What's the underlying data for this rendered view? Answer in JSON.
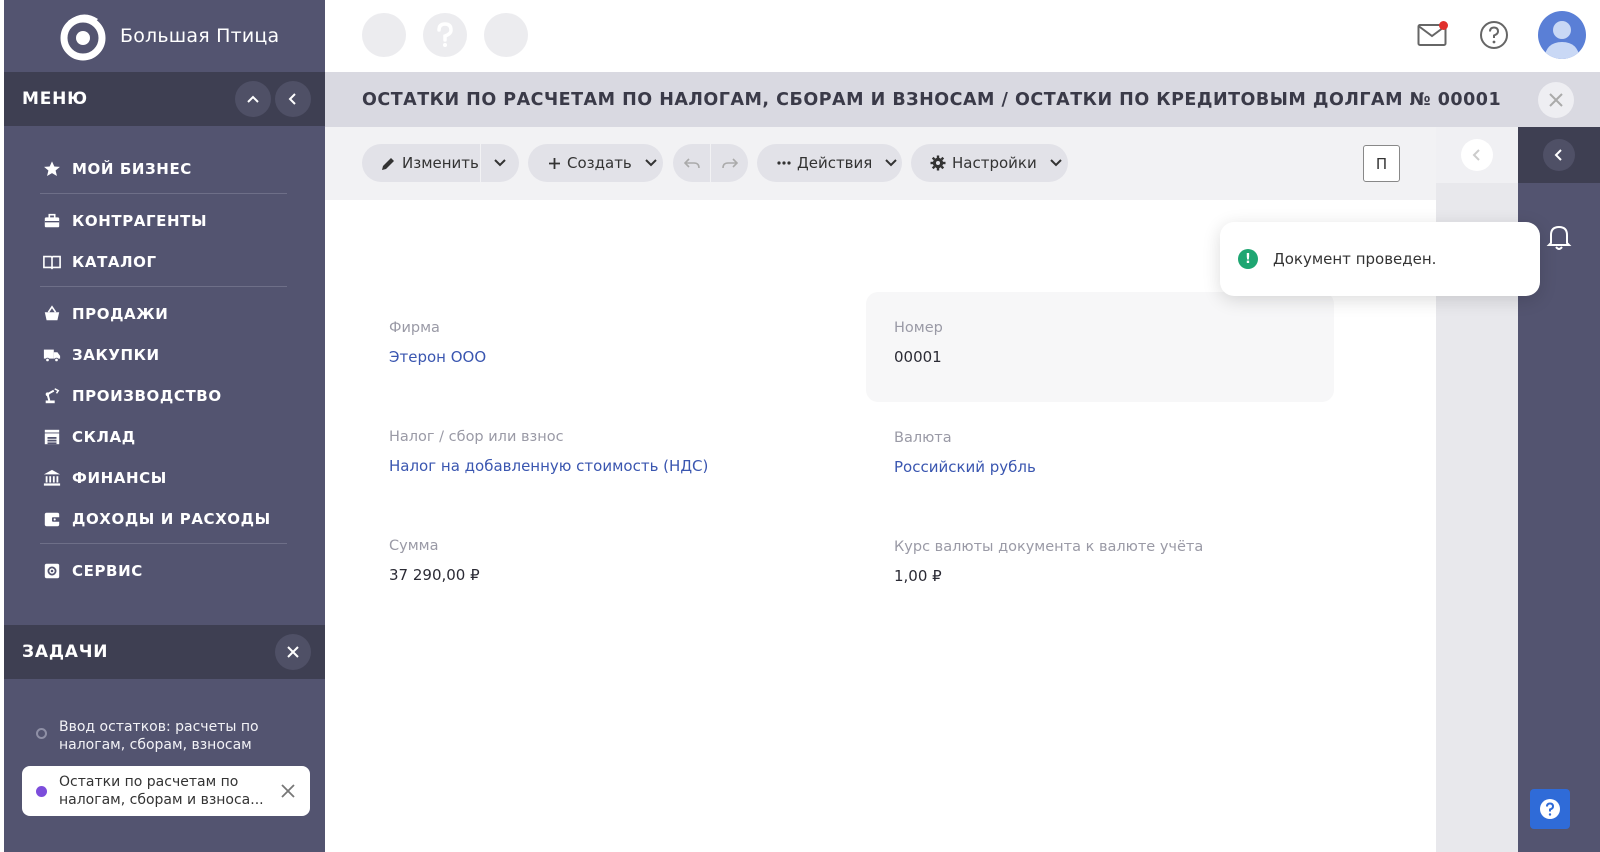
{
  "brand": {
    "name": "Большая Птица"
  },
  "menu": {
    "title": "МЕНЮ",
    "items": [
      {
        "label": "МОЙ БИЗНЕС",
        "icon": "star-icon"
      },
      {
        "label": "КОНТРАГЕНТЫ",
        "icon": "briefcase-icon"
      },
      {
        "label": "КАТАЛОГ",
        "icon": "book-icon"
      },
      {
        "label": "ПРОДАЖИ",
        "icon": "basket-icon"
      },
      {
        "label": "ЗАКУПКИ",
        "icon": "truck-icon"
      },
      {
        "label": "ПРОИЗВОДСТВО",
        "icon": "robot-arm-icon"
      },
      {
        "label": "СКЛАД",
        "icon": "warehouse-icon"
      },
      {
        "label": "ФИНАНСЫ",
        "icon": "bank-icon"
      },
      {
        "label": "ДОХОДЫ И РАСХОДЫ",
        "icon": "wallet-icon"
      },
      {
        "label": "СЕРВИС",
        "icon": "service-icon"
      }
    ]
  },
  "tasks": {
    "title": "ЗАДАЧИ",
    "items": [
      {
        "text": "Ввод остатков: расчеты по налогам, сборам, взносам"
      },
      {
        "text": "Остатки по расчетам по налогам, сборам и взноса..."
      }
    ]
  },
  "page": {
    "title": "ОСТАТКИ ПО РАСЧЕТАМ ПО НАЛОГАМ, СБОРАМ И ВЗНОСАМ / ОСТАТКИ ПО КРЕДИТОВЫМ ДОЛГАМ № 00001"
  },
  "toolbar": {
    "edit_label": "Изменить",
    "create_label": "Создать",
    "actions_label": "Действия",
    "settings_label": "Настройки",
    "square_label": "П"
  },
  "form": {
    "firm": {
      "label": "Фирма",
      "value": "Этерон ООО"
    },
    "number": {
      "label": "Номер",
      "value": "00001"
    },
    "tax": {
      "label": "Налог / сбор или взнос",
      "value": "Налог на добавленную стоимость (НДС)"
    },
    "currency": {
      "label": "Валюта",
      "value": "Российский рубль"
    },
    "amount": {
      "label": "Сумма",
      "value": "37 290,00 ₽"
    },
    "rate": {
      "label": "Курс валюты документа к валюте учёта",
      "value": "1,00 ₽"
    }
  },
  "toast": {
    "message": "Документ проведен."
  },
  "colors": {
    "sidebar": "#535470",
    "sidebar_header": "#3e3f52",
    "link": "#3a56b0",
    "success": "#1ea672",
    "help_button": "#2f6bd8",
    "mail_badge": "#e0312d",
    "task_active_dot": "#7c4ddb"
  }
}
